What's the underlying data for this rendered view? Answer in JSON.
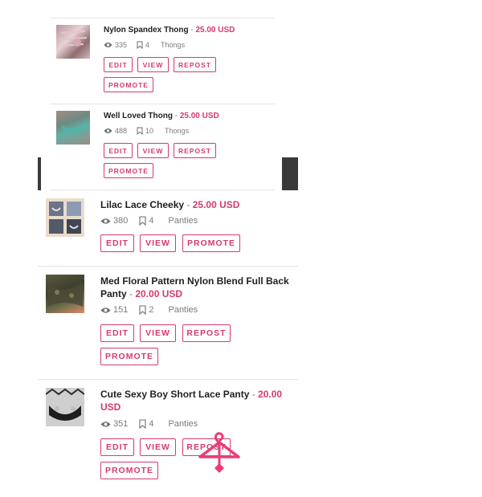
{
  "accent": "#d63a6f",
  "buttons": {
    "edit": "EDIT",
    "view": "VIEW",
    "repost": "REPOST",
    "promote": "PROMOTE"
  },
  "listings": [
    {
      "title": "Nylon Spandex Thong",
      "sep": " - ",
      "price": "25.00 USD",
      "views": "335",
      "saves": "4",
      "category": "Thongs"
    },
    {
      "title": "Well Loved Thong",
      "sep": " - ",
      "price": "25.00 USD",
      "views": "488",
      "saves": "10",
      "category": "Thongs"
    },
    {
      "title": "Lilac Lace Cheeky",
      "sep": " - ",
      "price": "25.00 USD",
      "views": "380",
      "saves": "4",
      "category": "Panties"
    },
    {
      "title": "Med Floral Pattern Nylon Blend Full Back Panty",
      "sep": " - ",
      "price": "20.00 USD",
      "views": "151",
      "saves": "2",
      "category": "Panties"
    },
    {
      "title": "Cute Sexy Boy Short Lace Panty",
      "sep": " - ",
      "price": "20.00 USD",
      "views": "351",
      "saves": "4",
      "category": "Panties"
    }
  ]
}
